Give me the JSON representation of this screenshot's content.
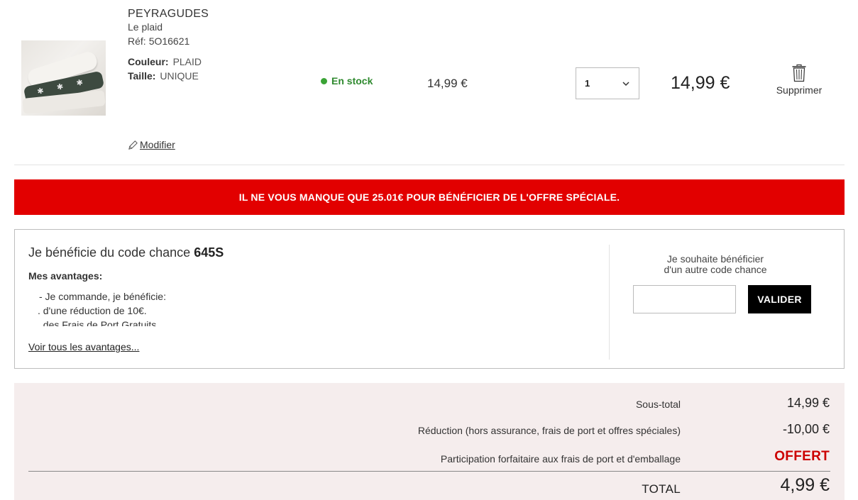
{
  "product": {
    "brand": "PEYRAGUDES",
    "name": "Le plaid",
    "ref_label": "Réf:",
    "ref_value": "5O16621",
    "color_label": "Couleur:",
    "color_value": "PLAID",
    "size_label": "Taille:",
    "size_value": "UNIQUE",
    "modify_label": "Modifier",
    "stock_label": "En stock",
    "stock_color": "#3aa335",
    "unit_price": "14,99 €",
    "quantity": "1",
    "total_price": "14,99 €",
    "delete_label": "Supprimer"
  },
  "banner": {
    "text": "IL NE VOUS MANQUE QUE 25.01€ POUR BÉNÉFICIER DE L'OFFRE SPÉCIALE.",
    "color": "#e20000"
  },
  "promo": {
    "title_prefix": "Je bénéficie du code chance",
    "code": "645S",
    "advantages_title": "Mes avantages:",
    "advantages": [
      "- Je commande, je bénéficie:",
      ". d'une réduction de 10€.",
      ". des Frais de Port Gratuits"
    ],
    "see_all_label": "Voir tous les avantages...",
    "other_code_line1": "Je souhaite bénéficier",
    "other_code_line2": "d'un autre code chance",
    "input_value": "",
    "validate_label": "VALIDER"
  },
  "summary": {
    "subtotal_label": "Sous-total",
    "subtotal_value": "14,99 €",
    "reduction_label": "Réduction (hors assurance, frais de port et offres spéciales)",
    "reduction_value": "-10,00 €",
    "shipping_label": "Participation forfaitaire aux frais de port et d'emballage",
    "shipping_value": "OFFERT",
    "total_label": "TOTAL",
    "total_value": "4,99 €",
    "background": "#f5eded",
    "offert_color": "#cc0000"
  }
}
